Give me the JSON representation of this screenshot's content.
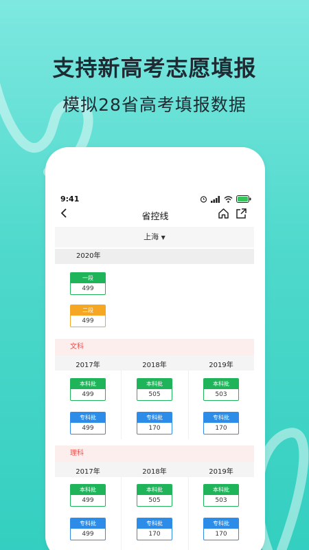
{
  "headline": "支持新高考志愿填报",
  "subline": "模拟28省高考填报数据",
  "phone": {
    "status_time": "9:41",
    "nav_title": "省控线",
    "province": "上海",
    "section_2020": {
      "year": "2020年",
      "items": [
        {
          "label": "一段",
          "value": "499",
          "color": "green"
        },
        {
          "label": "二段",
          "value": "499",
          "color": "orange"
        }
      ]
    },
    "wenke": {
      "label": "文科",
      "years": [
        "2017年",
        "2018年",
        "2019年"
      ],
      "benke": [
        {
          "label": "本科批",
          "value": "499"
        },
        {
          "label": "本科批",
          "value": "505"
        },
        {
          "label": "本科批",
          "value": "503"
        }
      ],
      "zhuanke": [
        {
          "label": "专科批",
          "value": "499"
        },
        {
          "label": "专科批",
          "value": "170"
        },
        {
          "label": "专科批",
          "value": "170"
        }
      ]
    },
    "like": {
      "label": "理科",
      "years": [
        "2017年",
        "2018年",
        "2019年"
      ],
      "benke": [
        {
          "label": "本科批",
          "value": "499"
        },
        {
          "label": "本科批",
          "value": "505"
        },
        {
          "label": "本科批",
          "value": "503"
        }
      ],
      "zhuanke": [
        {
          "label": "专科批",
          "value": "499"
        },
        {
          "label": "专科批",
          "value": "170"
        },
        {
          "label": "专科批",
          "value": "170"
        }
      ]
    }
  },
  "colors": {
    "green": "#1fb35a",
    "orange": "#f5a623",
    "blue": "#2d8ce8",
    "category_text": "#e8524f",
    "background": "#4fd9cc"
  },
  "icons": [
    "alarm-icon",
    "signal-icon",
    "wifi-icon",
    "battery-icon",
    "back-arrow-icon",
    "home-icon",
    "share-icon",
    "dropdown-caret-icon"
  ]
}
